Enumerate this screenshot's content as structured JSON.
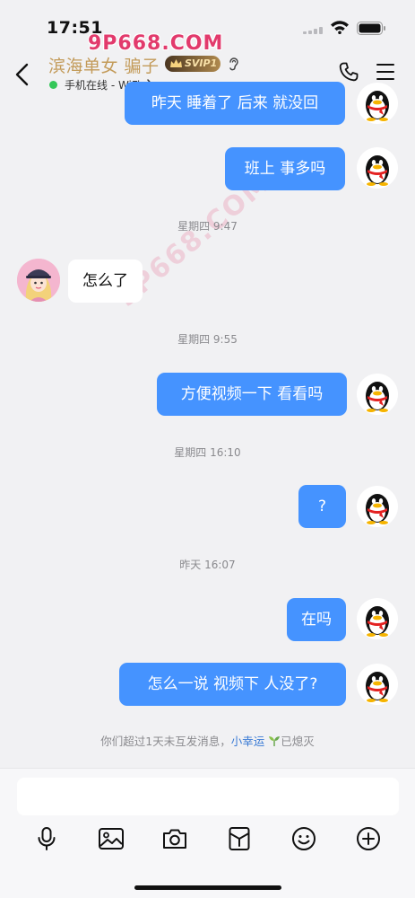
{
  "status_bar": {
    "time": "17:51"
  },
  "header": {
    "contact_name": "滨海单女 骗子",
    "badge": "SVIP1",
    "online_status": "手机在线 - WiFi",
    "watermark": "9P668.COM"
  },
  "messages": [
    {
      "type": "out",
      "text": "昨天 睡着了 后来 就没回"
    },
    {
      "type": "out",
      "text": "班上 事多吗"
    },
    {
      "type": "time",
      "text": "星期四 9:47"
    },
    {
      "type": "in",
      "text": "怎么了"
    },
    {
      "type": "time",
      "text": "星期四 9:55"
    },
    {
      "type": "out",
      "text": "方便视频一下 看看吗"
    },
    {
      "type": "time",
      "text": "星期四 16:10"
    },
    {
      "type": "out",
      "text": "?"
    },
    {
      "type": "time",
      "text": "昨天 16:07"
    },
    {
      "type": "out",
      "text": "在吗"
    },
    {
      "type": "out",
      "text": "怎么一说 视频下 人没了?"
    }
  ],
  "notice": {
    "prefix": "你们超过1天未互发消息，",
    "link": "小幸运",
    "suffix": "已熄灭"
  },
  "input": {
    "placeholder": ""
  },
  "toolbar": [
    "microphone-icon",
    "image-icon",
    "camera-icon",
    "red-packet-icon",
    "emoji-icon",
    "plus-icon"
  ],
  "colors": {
    "outgoing_bubble": "#4593ff",
    "background": "#f1f1f3",
    "name_gold": "#c39b5a",
    "online_green": "#34c759"
  }
}
